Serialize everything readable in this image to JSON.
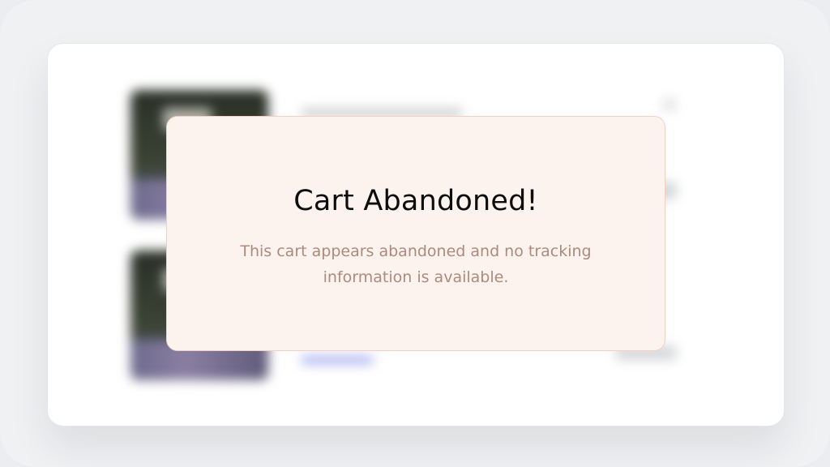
{
  "modal": {
    "title": "Cart Abandoned!",
    "message": "This cart appears abandoned and no tracking information is available."
  },
  "colors": {
    "modal_background": "#fdf3ee",
    "modal_border": "#f3cfc3",
    "message_text": "#ac8a7d",
    "title_text": "#0d0d0d"
  }
}
